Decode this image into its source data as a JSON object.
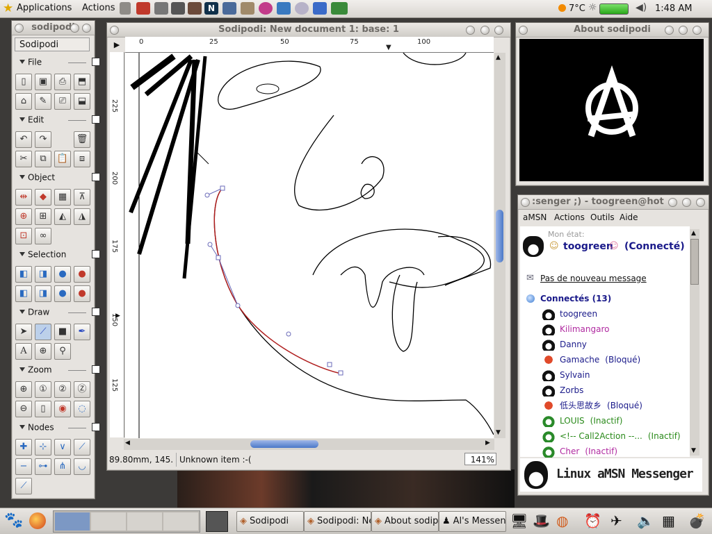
{
  "top_panel": {
    "applications": "Applications",
    "actions": "Actions",
    "temperature": "7°C",
    "clock": "1:48 AM",
    "tray_icons": [
      "volume-icon",
      "network-icon",
      "face-icon",
      "tux-icon",
      "netscape-icon",
      "windows-icon",
      "globe-icon",
      "users-icon",
      "cd-icon",
      "bird-icon",
      "turtle-icon"
    ]
  },
  "toolbox": {
    "title": "sodipodi",
    "app_label": "Sodipodi",
    "sections": {
      "file": "File",
      "edit": "Edit",
      "object": "Object",
      "selection": "Selection",
      "draw": "Draw",
      "zoom": "Zoom",
      "nodes": "Nodes"
    }
  },
  "editor": {
    "title": "Sodipodi: New document 1: base: 1",
    "ruler_top": [
      "0",
      "25",
      "50",
      "75",
      "100"
    ],
    "ruler_left": [
      "225",
      "200",
      "175",
      "150",
      "125"
    ],
    "status_coords": "89.80mm, 145.",
    "status_text": "Unknown item :-(",
    "zoom": "141%"
  },
  "about": {
    "title": "About sodipodi",
    "logo": "anarchy-a-logo"
  },
  "messenger": {
    "title": ":senger ;) - toogreen@hotm",
    "menu": [
      "aMSN",
      "Actions",
      "Outils",
      "Aide"
    ],
    "my_status_label": "Mon état:",
    "my_name": "toogreen",
    "my_state": "(Connecté)",
    "no_new_message": "Pas de nouveau message",
    "connected_header": "Connectés (13)",
    "contacts": [
      {
        "name": "toogreen",
        "status": "",
        "color": "#1a1a8a"
      },
      {
        "name": "Kilimangaro",
        "status": "",
        "color": "#b02aa0"
      },
      {
        "name": "Danny",
        "status": "",
        "color": "#1a1a8a"
      },
      {
        "name": "Gamache",
        "status": "(Bloqué)",
        "color": "#1a1a8a"
      },
      {
        "name": "Sylvain",
        "status": "",
        "color": "#1a1a8a"
      },
      {
        "name": "Zorbs",
        "status": "",
        "color": "#1a1a8a"
      },
      {
        "name": "低头思故乡",
        "status": "(Bloqué)",
        "color": "#1a1a8a"
      },
      {
        "name": "LOUIS",
        "status": "(Inactif)",
        "color": "#2a8a1a"
      },
      {
        "name": "<!-- Call2Action --...",
        "status": "(Inactif)",
        "color": "#2a8a1a"
      },
      {
        "name": "Cher",
        "status": "(Inactif)",
        "color": "#b02aa0"
      }
    ],
    "banner": "Linux aMSN Messenger"
  },
  "taskbar": {
    "tasks": [
      "Sodipodi",
      "Sodipodi: Ne",
      "About sodip",
      "Al's Messen"
    ]
  }
}
